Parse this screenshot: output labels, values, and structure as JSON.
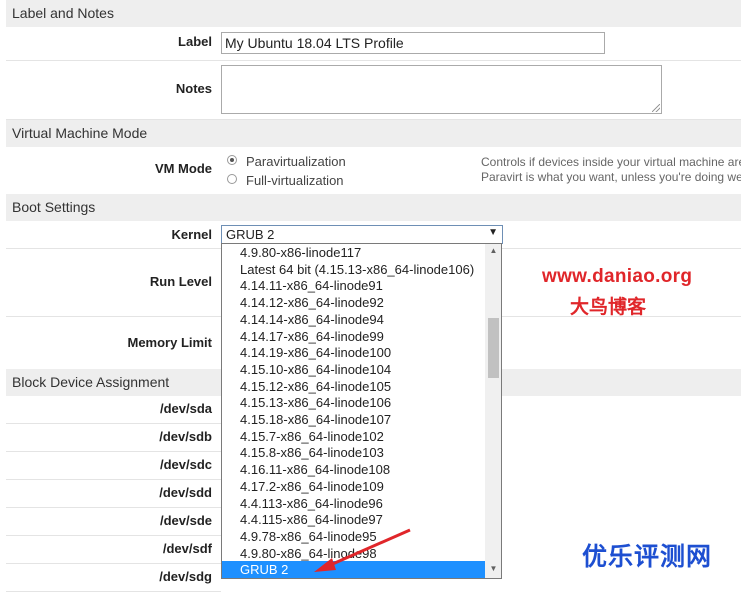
{
  "sections": {
    "label_notes": "Label and Notes",
    "vm_mode": "Virtual Machine Mode",
    "boot": "Boot Settings",
    "block": "Block Device Assignment"
  },
  "fields": {
    "label_label": "Label",
    "label_value": "My Ubuntu 18.04 LTS Profile",
    "notes_label": "Notes",
    "vm_mode_label": "VM Mode",
    "vm_options": [
      "Paravirtualization",
      "Full-virtualization"
    ],
    "vm_selected": "Paravirtualization",
    "vm_help_1": "Controls if devices inside your virtual machine are",
    "vm_help_2": "Paravirt is what you want, unless you're doing we",
    "kernel_label": "Kernel",
    "kernel_value": "GRUB 2",
    "kernel_arrow": "▼",
    "run_level_label": "Run Level",
    "memory_limit_label": "Memory Limit"
  },
  "kernel_options": [
    "4.9.80-x86-linode117",
    "Latest 64 bit (4.15.13-x86_64-linode106)",
    "4.14.11-x86_64-linode91",
    "4.14.12-x86_64-linode92",
    "4.14.14-x86_64-linode94",
    "4.14.17-x86_64-linode99",
    "4.14.19-x86_64-linode100",
    "4.15.10-x86_64-linode104",
    "4.15.12-x86_64-linode105",
    "4.15.13-x86_64-linode106",
    "4.15.18-x86_64-linode107",
    "4.15.7-x86_64-linode102",
    "4.15.8-x86_64-linode103",
    "4.16.11-x86_64-linode108",
    "4.17.2-x86_64-linode109",
    "4.4.113-x86_64-linode96",
    "4.4.115-x86_64-linode97",
    "4.9.78-x86_64-linode95",
    "4.9.80-x86_64-linode98",
    "GRUB 2"
  ],
  "devices": [
    "/dev/sda",
    "/dev/sdb",
    "/dev/sdc",
    "/dev/sdd",
    "/dev/sde",
    "/dev/sdf",
    "/dev/sdg"
  ],
  "watermarks": {
    "url": "www.daniao.org",
    "cn_blog": "大鸟博客",
    "cn_review": "优乐评测网"
  },
  "colors": {
    "selected_option": "#1e90ff",
    "watermark_red": "#e0262a",
    "watermark_blue": "#1d4fd1"
  }
}
